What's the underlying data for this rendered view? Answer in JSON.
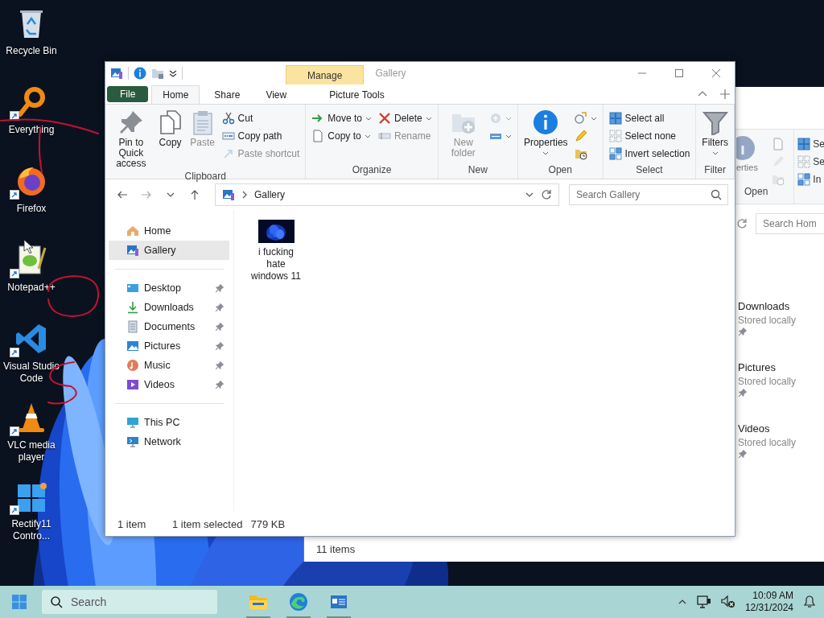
{
  "desktop_icons": [
    {
      "label": "Recycle Bin",
      "shortcut": false
    },
    {
      "label": "Everything",
      "shortcut": true
    },
    {
      "label": "Firefox",
      "shortcut": true
    },
    {
      "label": "Notepad++",
      "shortcut": true
    },
    {
      "label": "Visual Studio Code",
      "shortcut": true
    },
    {
      "label": "VLC media player",
      "shortcut": true
    },
    {
      "label": "Rectify11 Contro...",
      "shortcut": true
    }
  ],
  "back_window": {
    "ribbon": {
      "properties_label": "erties",
      "group_label": "Open",
      "select_items": [
        "Se",
        "Se",
        "In"
      ]
    },
    "search": {
      "placeholder": "Search Hom"
    },
    "items": [
      {
        "name": "Downloads",
        "detail": "Stored locally",
        "pinned": true
      },
      {
        "name": "Pictures",
        "detail": "Stored locally",
        "pinned": true
      },
      {
        "name": "Videos",
        "detail": "Stored locally",
        "pinned": true
      }
    ],
    "status_bar": "11 items"
  },
  "window": {
    "context_tab": "Manage",
    "title": "Gallery",
    "tabs": [
      {
        "label": "File",
        "kind": "file",
        "selected": false
      },
      {
        "label": "Home",
        "kind": "tab",
        "selected": true
      },
      {
        "label": "Share",
        "kind": "tab",
        "selected": false
      },
      {
        "label": "View",
        "kind": "tab",
        "selected": false
      },
      {
        "label": "Picture Tools",
        "kind": "context",
        "selected": false
      }
    ],
    "ribbon": [
      {
        "label": "Clipboard",
        "columns": [
          {
            "kind": "large",
            "items": [
              {
                "label": "Pin to Quick access",
                "disabled": false,
                "dropdown": false
              }
            ]
          },
          {
            "kind": "large",
            "items": [
              {
                "label": "Copy",
                "disabled": false,
                "dropdown": false
              }
            ]
          },
          {
            "kind": "large",
            "items": [
              {
                "label": "Paste",
                "disabled": true,
                "dropdown": false
              }
            ]
          },
          {
            "kind": "small",
            "items": [
              {
                "label": "Cut",
                "disabled": false,
                "dropdown": false
              },
              {
                "label": "Copy path",
                "disabled": false,
                "dropdown": false
              },
              {
                "label": "Paste shortcut",
                "disabled": true,
                "dropdown": false
              }
            ]
          }
        ]
      },
      {
        "label": "Organize",
        "columns": [
          {
            "kind": "small",
            "items": [
              {
                "label": "Move to",
                "disabled": false,
                "dropdown": true
              },
              {
                "label": "Copy to",
                "disabled": false,
                "dropdown": true
              }
            ]
          },
          {
            "kind": "small",
            "items": [
              {
                "label": "Delete",
                "disabled": false,
                "dropdown": true
              },
              {
                "label": "Rename",
                "disabled": true,
                "dropdown": false
              }
            ]
          }
        ]
      },
      {
        "label": "New",
        "columns": [
          {
            "kind": "large",
            "items": [
              {
                "label": "New folder",
                "disabled": true,
                "dropdown": false
              }
            ]
          },
          {
            "kind": "small",
            "items": [
              {
                "disabled": true,
                "dropdown": true
              },
              {
                "disabled": false,
                "dropdown": true
              }
            ]
          }
        ]
      },
      {
        "label": "Open",
        "columns": [
          {
            "kind": "large",
            "items": [
              {
                "label": "Properties",
                "disabled": false,
                "dropdown": true
              }
            ]
          },
          {
            "kind": "small",
            "items": [
              {
                "disabled": false,
                "dropdown": true
              },
              {
                "disabled": false,
                "dropdown": false
              },
              {
                "disabled": false,
                "dropdown": false
              }
            ]
          }
        ]
      },
      {
        "label": "Select",
        "columns": [
          {
            "kind": "small",
            "items": [
              {
                "label": "Select all",
                "disabled": false,
                "dropdown": false
              },
              {
                "label": "Select none",
                "disabled": false,
                "dropdown": false
              },
              {
                "label": "Invert selection",
                "disabled": false,
                "dropdown": false
              }
            ]
          }
        ]
      },
      {
        "label": "Filter",
        "columns": [
          {
            "kind": "large",
            "items": [
              {
                "label": "Filters",
                "disabled": false,
                "dropdown": true
              }
            ]
          }
        ]
      }
    ],
    "address": {
      "path": [
        "Gallery"
      ]
    },
    "search": {
      "placeholder": "Search Gallery"
    },
    "navigation": [
      {
        "items": [
          {
            "label": "Home",
            "selected": false,
            "pinned": false
          },
          {
            "label": "Gallery",
            "selected": true,
            "pinned": false
          }
        ]
      },
      {
        "items": [
          {
            "label": "Desktop",
            "selected": false,
            "pinned": true
          },
          {
            "label": "Downloads",
            "selected": false,
            "pinned": true
          },
          {
            "label": "Documents",
            "selected": false,
            "pinned": true
          },
          {
            "label": "Pictures",
            "selected": false,
            "pinned": true
          },
          {
            "label": "Music",
            "selected": false,
            "pinned": true
          },
          {
            "label": "Videos",
            "selected": false,
            "pinned": true
          }
        ]
      },
      {
        "items": [
          {
            "label": "This PC",
            "selected": false,
            "pinned": false
          },
          {
            "label": "Network",
            "selected": false,
            "pinned": false
          }
        ]
      }
    ],
    "files": [
      {
        "name": "i fucking hate windows 11",
        "kind": "picture"
      }
    ],
    "status_bar": [
      "1 item",
      "1 item selected",
      "779 KB"
    ]
  },
  "taskbar": {
    "search": {
      "placeholder": "Search"
    },
    "apps": [
      {
        "running": true
      },
      {
        "running": true
      },
      {
        "running": true
      }
    ],
    "time": "10:09 AM",
    "date": "12/31/2024"
  }
}
